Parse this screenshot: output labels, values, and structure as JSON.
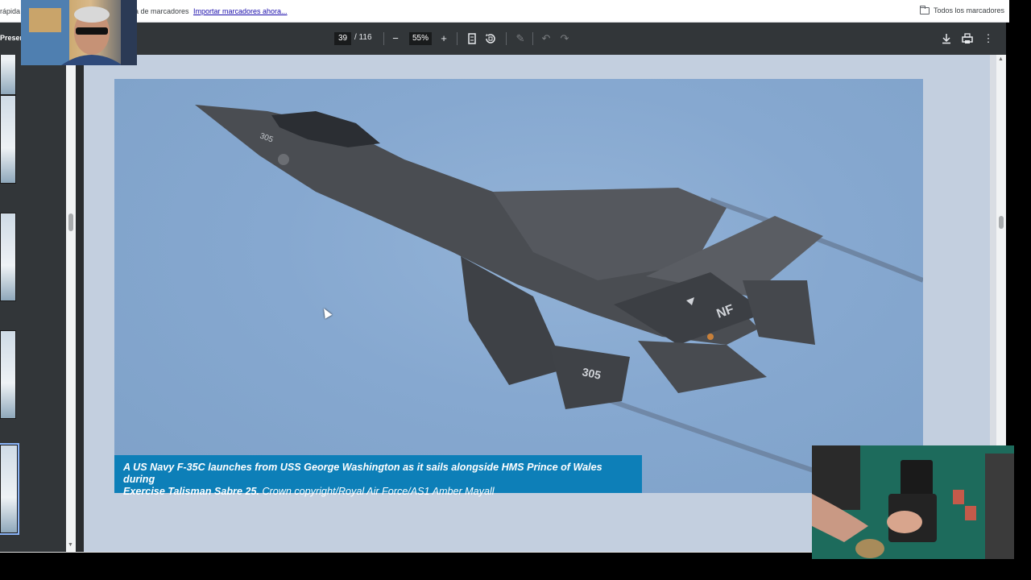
{
  "bookmarks_bar": {
    "left_fragment": "rápida",
    "prefix_text": "ra de marcadores",
    "import_link": "Importar marcadores ahora...",
    "all_bookmarks": "Todos los marcadores"
  },
  "toolbar": {
    "title_fragment": "Presen",
    "current_page": "39",
    "total_pages": "/ 116",
    "zoom": "55%",
    "icons": [
      "zoom-out-icon",
      "zoom-in-icon",
      "fit-page-icon",
      "rotate-icon",
      "annotate-icon",
      "undo-icon",
      "redo-icon",
      "download-icon",
      "print-icon",
      "more-icon"
    ]
  },
  "page": {
    "caption_bold": "A US Navy F-35C launches from USS George Washington as it sails alongside HMS",
    "caption_middle": " Prince of Wales during",
    "caption_bold2": "Exercise Talisman Sabre 25.",
    "caption_rest": " Crown copyright/Royal Air Force/AS1 Amber Mayall",
    "aircraft_markings": [
      "305",
      "NF",
      "305"
    ]
  },
  "colors": {
    "toolbar_bg": "#323639",
    "caption_bg": "#0d7fb8",
    "sky": "#86a8d0",
    "aircraft": "#4a4d52"
  }
}
